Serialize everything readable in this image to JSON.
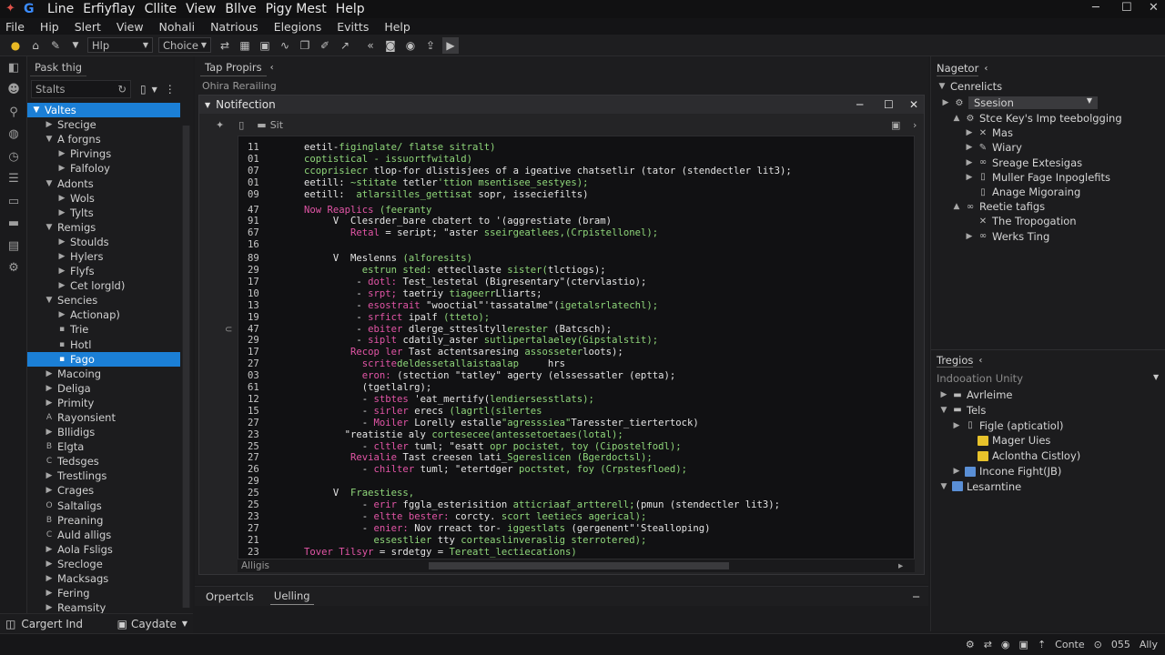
{
  "titlebar": {
    "menus": [
      "Line",
      "Erfiyflay",
      "Cllite",
      "View",
      "Bllve",
      "Pigy Mest",
      "Help"
    ],
    "window_controls": [
      "─",
      "☐",
      "✕"
    ]
  },
  "menubar": [
    "File",
    "Hip",
    "Slert",
    "View",
    "Nohali",
    "Natrious",
    "Elegions",
    "Evitts",
    "Help"
  ],
  "toolbar": {
    "field1": "Hlp",
    "field2": "Choice"
  },
  "left_panel": {
    "tab": "Pask thig",
    "search_placeholder": "Stalts",
    "tree": [
      {
        "label": "Valtes",
        "indent": 0,
        "twisty": "▼",
        "selected": true
      },
      {
        "label": "Srecige",
        "indent": 1,
        "twisty": "▶"
      },
      {
        "label": "A forgns",
        "indent": 1,
        "twisty": "▼"
      },
      {
        "label": "Pirvings",
        "indent": 2,
        "twisty": "▶"
      },
      {
        "label": "Falfoloy",
        "indent": 2,
        "twisty": "▶"
      },
      {
        "label": "Adonts",
        "indent": 1,
        "twisty": "▼"
      },
      {
        "label": "Wols",
        "indent": 2,
        "twisty": "▶"
      },
      {
        "label": "Tylts",
        "indent": 2,
        "twisty": "▶"
      },
      {
        "label": "Remigs",
        "indent": 1,
        "twisty": "▼"
      },
      {
        "label": "Stoulds",
        "indent": 2,
        "twisty": "▶"
      },
      {
        "label": "Hylers",
        "indent": 2,
        "twisty": "▶"
      },
      {
        "label": "Flyfs",
        "indent": 2,
        "twisty": "▶"
      },
      {
        "label": "Cet lorgld)",
        "indent": 2,
        "twisty": "▶"
      },
      {
        "label": "Sencies",
        "indent": 1,
        "twisty": "▼"
      },
      {
        "label": "Actionap)",
        "indent": 2,
        "twisty": "▶"
      },
      {
        "label": "Trie",
        "indent": 2,
        "twisty": "▪"
      },
      {
        "label": "Hotl",
        "indent": 2,
        "twisty": "▪"
      },
      {
        "label": "Fago",
        "indent": 2,
        "twisty": "▪",
        "selected": true
      },
      {
        "label": "Macoing",
        "indent": 1,
        "twisty": "▶"
      },
      {
        "label": "Deliga",
        "indent": 1,
        "twisty": "▶"
      },
      {
        "label": "Primity",
        "indent": 1,
        "twisty": "▶"
      },
      {
        "label": "Rayonsient",
        "indent": 1,
        "twisty": "A"
      },
      {
        "label": "Bllidigs",
        "indent": 1,
        "twisty": "▶"
      },
      {
        "label": "Elgta",
        "indent": 1,
        "twisty": "B"
      },
      {
        "label": "Tedsges",
        "indent": 1,
        "twisty": "C"
      },
      {
        "label": "Trestlings",
        "indent": 1,
        "twisty": "▶"
      },
      {
        "label": "Crages",
        "indent": 1,
        "twisty": "▶"
      },
      {
        "label": "Saltaligs",
        "indent": 1,
        "twisty": "O"
      },
      {
        "label": "Preaning",
        "indent": 1,
        "twisty": "B"
      },
      {
        "label": "Auld alligs",
        "indent": 1,
        "twisty": "C"
      },
      {
        "label": "Aola Fsligs",
        "indent": 1,
        "twisty": "▶"
      },
      {
        "label": "Srecloge",
        "indent": 1,
        "twisty": "▶"
      },
      {
        "label": "Macksags",
        "indent": 1,
        "twisty": "▶"
      },
      {
        "label": "Fering",
        "indent": 1,
        "twisty": "▶"
      },
      {
        "label": "Reamsity",
        "indent": 1,
        "twisty": "▶"
      }
    ],
    "bottom_left": "Cargert Ind",
    "bottom_right": "Caydate"
  },
  "center": {
    "tab": "Tap Propirs",
    "subtitle": "Ohira Rerailing",
    "window_title": "Notifection",
    "tool_label": "Sit",
    "code_lines": [
      {
        "n": "11",
        "parts": [
          [
            "wh",
            "eetil-"
          ],
          [
            "gr",
            "figinglate/ flatse sitralt)"
          ]
        ]
      },
      {
        "n": "01",
        "parts": [
          [
            "gr",
            "coptistical - issuortfwitald)"
          ]
        ]
      },
      {
        "n": "07",
        "parts": [
          [
            "gr",
            "ccoprisiecr "
          ],
          [
            "wh",
            "tlop-for dlistisjees of a igeative chatsetlir (tator (stendectler lit3);"
          ]
        ]
      },
      {
        "n": "01",
        "parts": [
          [
            "wh",
            "eetill: "
          ],
          [
            "gr",
            "~stitate "
          ],
          [
            "wh",
            "tetler"
          ],
          [
            "gr",
            "'ttion msentisee_sestyes);"
          ]
        ]
      },
      {
        "n": "09",
        "parts": [
          [
            "wh",
            "eetill:  "
          ],
          [
            "gr",
            "atlarsilles_gettisat "
          ],
          [
            "wh",
            "sopr, isseciefilts)"
          ]
        ]
      },
      {
        "n": "47",
        "parts": [
          [
            "kw",
            "Now Reaplics "
          ],
          [
            "gr",
            "(feeranty"
          ]
        ]
      },
      {
        "n": "91",
        "parts": [
          [
            "wh",
            "     V  Clesrder_bare cbatert to '(aggrestiate (bram)"
          ]
        ]
      },
      {
        "n": "67",
        "parts": [
          [
            "wh",
            "        "
          ],
          [
            "kw",
            "Retal "
          ],
          [
            "wh",
            "= seript; \"aster "
          ],
          [
            "gr",
            "sseirgeatlees,(Crpistellonel);"
          ]
        ]
      },
      {
        "n": "16",
        "parts": []
      },
      {
        "n": "89",
        "parts": [
          [
            "wh",
            "     V  Meslenns "
          ],
          [
            "gr",
            "(alforesits)"
          ]
        ]
      },
      {
        "n": "29",
        "parts": [
          [
            "wh",
            "          "
          ],
          [
            "gr",
            "estrun sted: "
          ],
          [
            "wh",
            "ettecllaste "
          ],
          [
            "gr",
            "sister("
          ],
          [
            "wh",
            "tlctiogs);"
          ]
        ]
      },
      {
        "n": "17",
        "parts": [
          [
            "wh",
            "         - "
          ],
          [
            "kw",
            "dotl: "
          ],
          [
            "wh",
            "Test_lestetal (Bigresentary\"(ctervlastio);"
          ]
        ]
      },
      {
        "n": "10",
        "parts": [
          [
            "wh",
            "         - "
          ],
          [
            "kw",
            "srpt; "
          ],
          [
            "wh",
            "taetriy "
          ],
          [
            "gr",
            "tiageerr"
          ],
          [
            "wh",
            "Lliarts;"
          ]
        ]
      },
      {
        "n": "13",
        "parts": [
          [
            "wh",
            "         - "
          ],
          [
            "kw",
            "esostrait "
          ],
          [
            "wh",
            "\"wooctial\"'tassatalme\"("
          ],
          [
            "gr",
            "igetalsrlatechl);"
          ]
        ]
      },
      {
        "n": "19",
        "parts": [
          [
            "wh",
            "         - "
          ],
          [
            "kw",
            "srfict "
          ],
          [
            "wh",
            "ipalf "
          ],
          [
            "gr",
            "(tteto);"
          ]
        ]
      },
      {
        "n": "47",
        "parts": [
          [
            "wh",
            "         - "
          ],
          [
            "kw",
            "ebiter "
          ],
          [
            "wh",
            "dlerge_sttesltyll"
          ],
          [
            "gr",
            "erester "
          ],
          [
            "wh",
            "(Batcsch);"
          ]
        ]
      },
      {
        "n": "29",
        "parts": [
          [
            "wh",
            "         - "
          ],
          [
            "kw",
            "siplt "
          ],
          [
            "wh",
            "cdatily_aster "
          ],
          [
            "gr",
            "sutlipertalaeley(Gipstalstit);"
          ]
        ]
      },
      {
        "n": "17",
        "parts": [
          [
            "kw",
            "        Recop ler "
          ],
          [
            "wh",
            "Tast actentsaresing "
          ],
          [
            "gr",
            "assosseter"
          ],
          [
            "wh",
            "loots);"
          ]
        ]
      },
      {
        "n": "27",
        "parts": [
          [
            "wh",
            "          "
          ],
          [
            "kw",
            "scrite"
          ],
          [
            "gr",
            "deldessetallaistaalap     "
          ],
          [
            "wh",
            "hrs"
          ]
        ]
      },
      {
        "n": "03",
        "parts": [
          [
            "wh",
            "          "
          ],
          [
            "kw",
            "eron: "
          ],
          [
            "wh",
            "(stection \"tatley\" agerty (elssessatler (eptta);"
          ]
        ]
      },
      {
        "n": "61",
        "parts": [
          [
            "wh",
            "          (tgetlalrg);"
          ]
        ]
      },
      {
        "n": "12",
        "parts": [
          [
            "wh",
            "          - "
          ],
          [
            "kw",
            "stbtes "
          ],
          [
            "wh",
            "'eat_mertify("
          ],
          [
            "gr",
            "lendiersesstlats);"
          ]
        ]
      },
      {
        "n": "15",
        "parts": [
          [
            "wh",
            "          - "
          ],
          [
            "kw",
            "sirler "
          ],
          [
            "wh",
            "erecs "
          ],
          [
            "gr",
            "(lagrtl(silertes"
          ]
        ]
      },
      {
        "n": "27",
        "parts": [
          [
            "wh",
            "          - "
          ],
          [
            "kw",
            "Moiler "
          ],
          [
            "wh",
            "Lorelly estalle"
          ],
          [
            "gr",
            "\"agresssiea\""
          ],
          [
            "wh",
            "Taresster_tiertertock)"
          ]
        ]
      },
      {
        "n": "23",
        "parts": [
          [
            "wh",
            "       \"reatistie aly "
          ],
          [
            "gr",
            "cortesecee(antessetoetaes(lotal);"
          ]
        ]
      },
      {
        "n": "25",
        "parts": [
          [
            "wh",
            "          - "
          ],
          [
            "kw",
            "cltler "
          ],
          [
            "wh",
            "tuml; \"esatt "
          ],
          [
            "gr",
            "opr pocistet, toy (Cipostelfodl);"
          ]
        ]
      },
      {
        "n": "27",
        "parts": [
          [
            "kw",
            "        Revialie "
          ],
          [
            "wh",
            "Tast creesen lati_"
          ],
          [
            "gr",
            "Sgereslicen (Bgerdoctsl);"
          ]
        ]
      },
      {
        "n": "26",
        "parts": [
          [
            "wh",
            "          - "
          ],
          [
            "kw",
            "chilter "
          ],
          [
            "wh",
            "tuml; \"etertdger "
          ],
          [
            "gr",
            "poctstet, foy (Crpstesfloed);"
          ]
        ]
      },
      {
        "n": "29",
        "parts": []
      },
      {
        "n": "25",
        "parts": [
          [
            "wh",
            "     V  "
          ],
          [
            "gr",
            "Fraestiess,"
          ]
        ]
      },
      {
        "n": "25",
        "parts": [
          [
            "wh",
            "          - "
          ],
          [
            "kw",
            "erir "
          ],
          [
            "wh",
            "fggla_esterisition "
          ],
          [
            "gr",
            "atticriaaf_artterell;"
          ],
          [
            "wh",
            "(pmun (stendectler lit3);"
          ]
        ]
      },
      {
        "n": "23",
        "parts": [
          [
            "wh",
            "          - "
          ],
          [
            "kw",
            "eltte bester: "
          ],
          [
            "wh",
            "corcty. "
          ],
          [
            "gr",
            "scort leetiecs agerical);"
          ]
        ]
      },
      {
        "n": "27",
        "parts": [
          [
            "wh",
            "          - "
          ],
          [
            "kw",
            "enier: "
          ],
          [
            "wh",
            "Nov rreact tor- "
          ],
          [
            "gr",
            "iggestlats "
          ],
          [
            "wh",
            "(gergenent\"'Stealloping)"
          ]
        ]
      },
      {
        "n": "21",
        "parts": [
          [
            "wh",
            "            "
          ],
          [
            "gr",
            "essestlier "
          ],
          [
            "wh",
            "tty "
          ],
          [
            "gr",
            "corteaslinveraslig sterrotered);"
          ]
        ]
      },
      {
        "n": "23",
        "parts": [
          [
            "kw",
            "Tover Tilsyr "
          ],
          [
            "wh",
            "= srdetgy = "
          ],
          [
            "gr",
            "Tereatt_lectiecations)"
          ]
        ]
      }
    ],
    "hscroll_label": "Alligis",
    "bottom_tabs": [
      "Orpertcls",
      "Uelling"
    ]
  },
  "right_panel": {
    "tab": "Nagetor",
    "section1": "Cenrelicts",
    "section1_field": "Ssesion",
    "items1": [
      {
        "label": "Stce Key's Imp teebolgging",
        "indent": 1,
        "twisty": "▲",
        "icon": "gear"
      },
      {
        "label": "Mas",
        "indent": 2,
        "twisty": "▶",
        "icon": "tool"
      },
      {
        "label": "Wiary",
        "indent": 2,
        "twisty": "▶",
        "icon": "pen"
      },
      {
        "label": "Sreage Extesigas",
        "indent": 2,
        "twisty": "▶",
        "icon": "link"
      },
      {
        "label": "Muller Fage Inpoglefits",
        "indent": 2,
        "twisty": "▶",
        "icon": "doc"
      },
      {
        "label": "Anage Migoraing",
        "indent": 2,
        "twisty": "",
        "icon": "doc"
      },
      {
        "label": "Reetie tafigs",
        "indent": 1,
        "twisty": "▲",
        "icon": "link"
      },
      {
        "label": "The Tropogation",
        "indent": 2,
        "twisty": "",
        "icon": "tool"
      },
      {
        "label": "Werks Ting",
        "indent": 2,
        "twisty": "▶",
        "icon": "link"
      }
    ],
    "section2": "Tregios",
    "section2_sub": "Indooation Unity",
    "items2": [
      {
        "label": "Avrleime",
        "indent": 0,
        "twisty": "▶",
        "icon": "folder"
      },
      {
        "label": "Tels",
        "indent": 0,
        "twisty": "▼",
        "icon": "folder"
      },
      {
        "label": "Figle (apticatiol)",
        "indent": 1,
        "twisty": "▶",
        "icon": "doc"
      },
      {
        "label": "Mager Uies",
        "indent": 2,
        "twisty": "",
        "icon": "yellow"
      },
      {
        "label": "Aclontha Cistloy)",
        "indent": 2,
        "twisty": "",
        "icon": "yellow"
      },
      {
        "label": "Incone Fight(JB)",
        "indent": 1,
        "twisty": "▶",
        "icon": "blue"
      },
      {
        "label": "Lesarntine",
        "indent": 0,
        "twisty": "▼",
        "icon": "blue"
      }
    ]
  },
  "statusbar": [
    "Conte",
    "055",
    "Ally"
  ]
}
